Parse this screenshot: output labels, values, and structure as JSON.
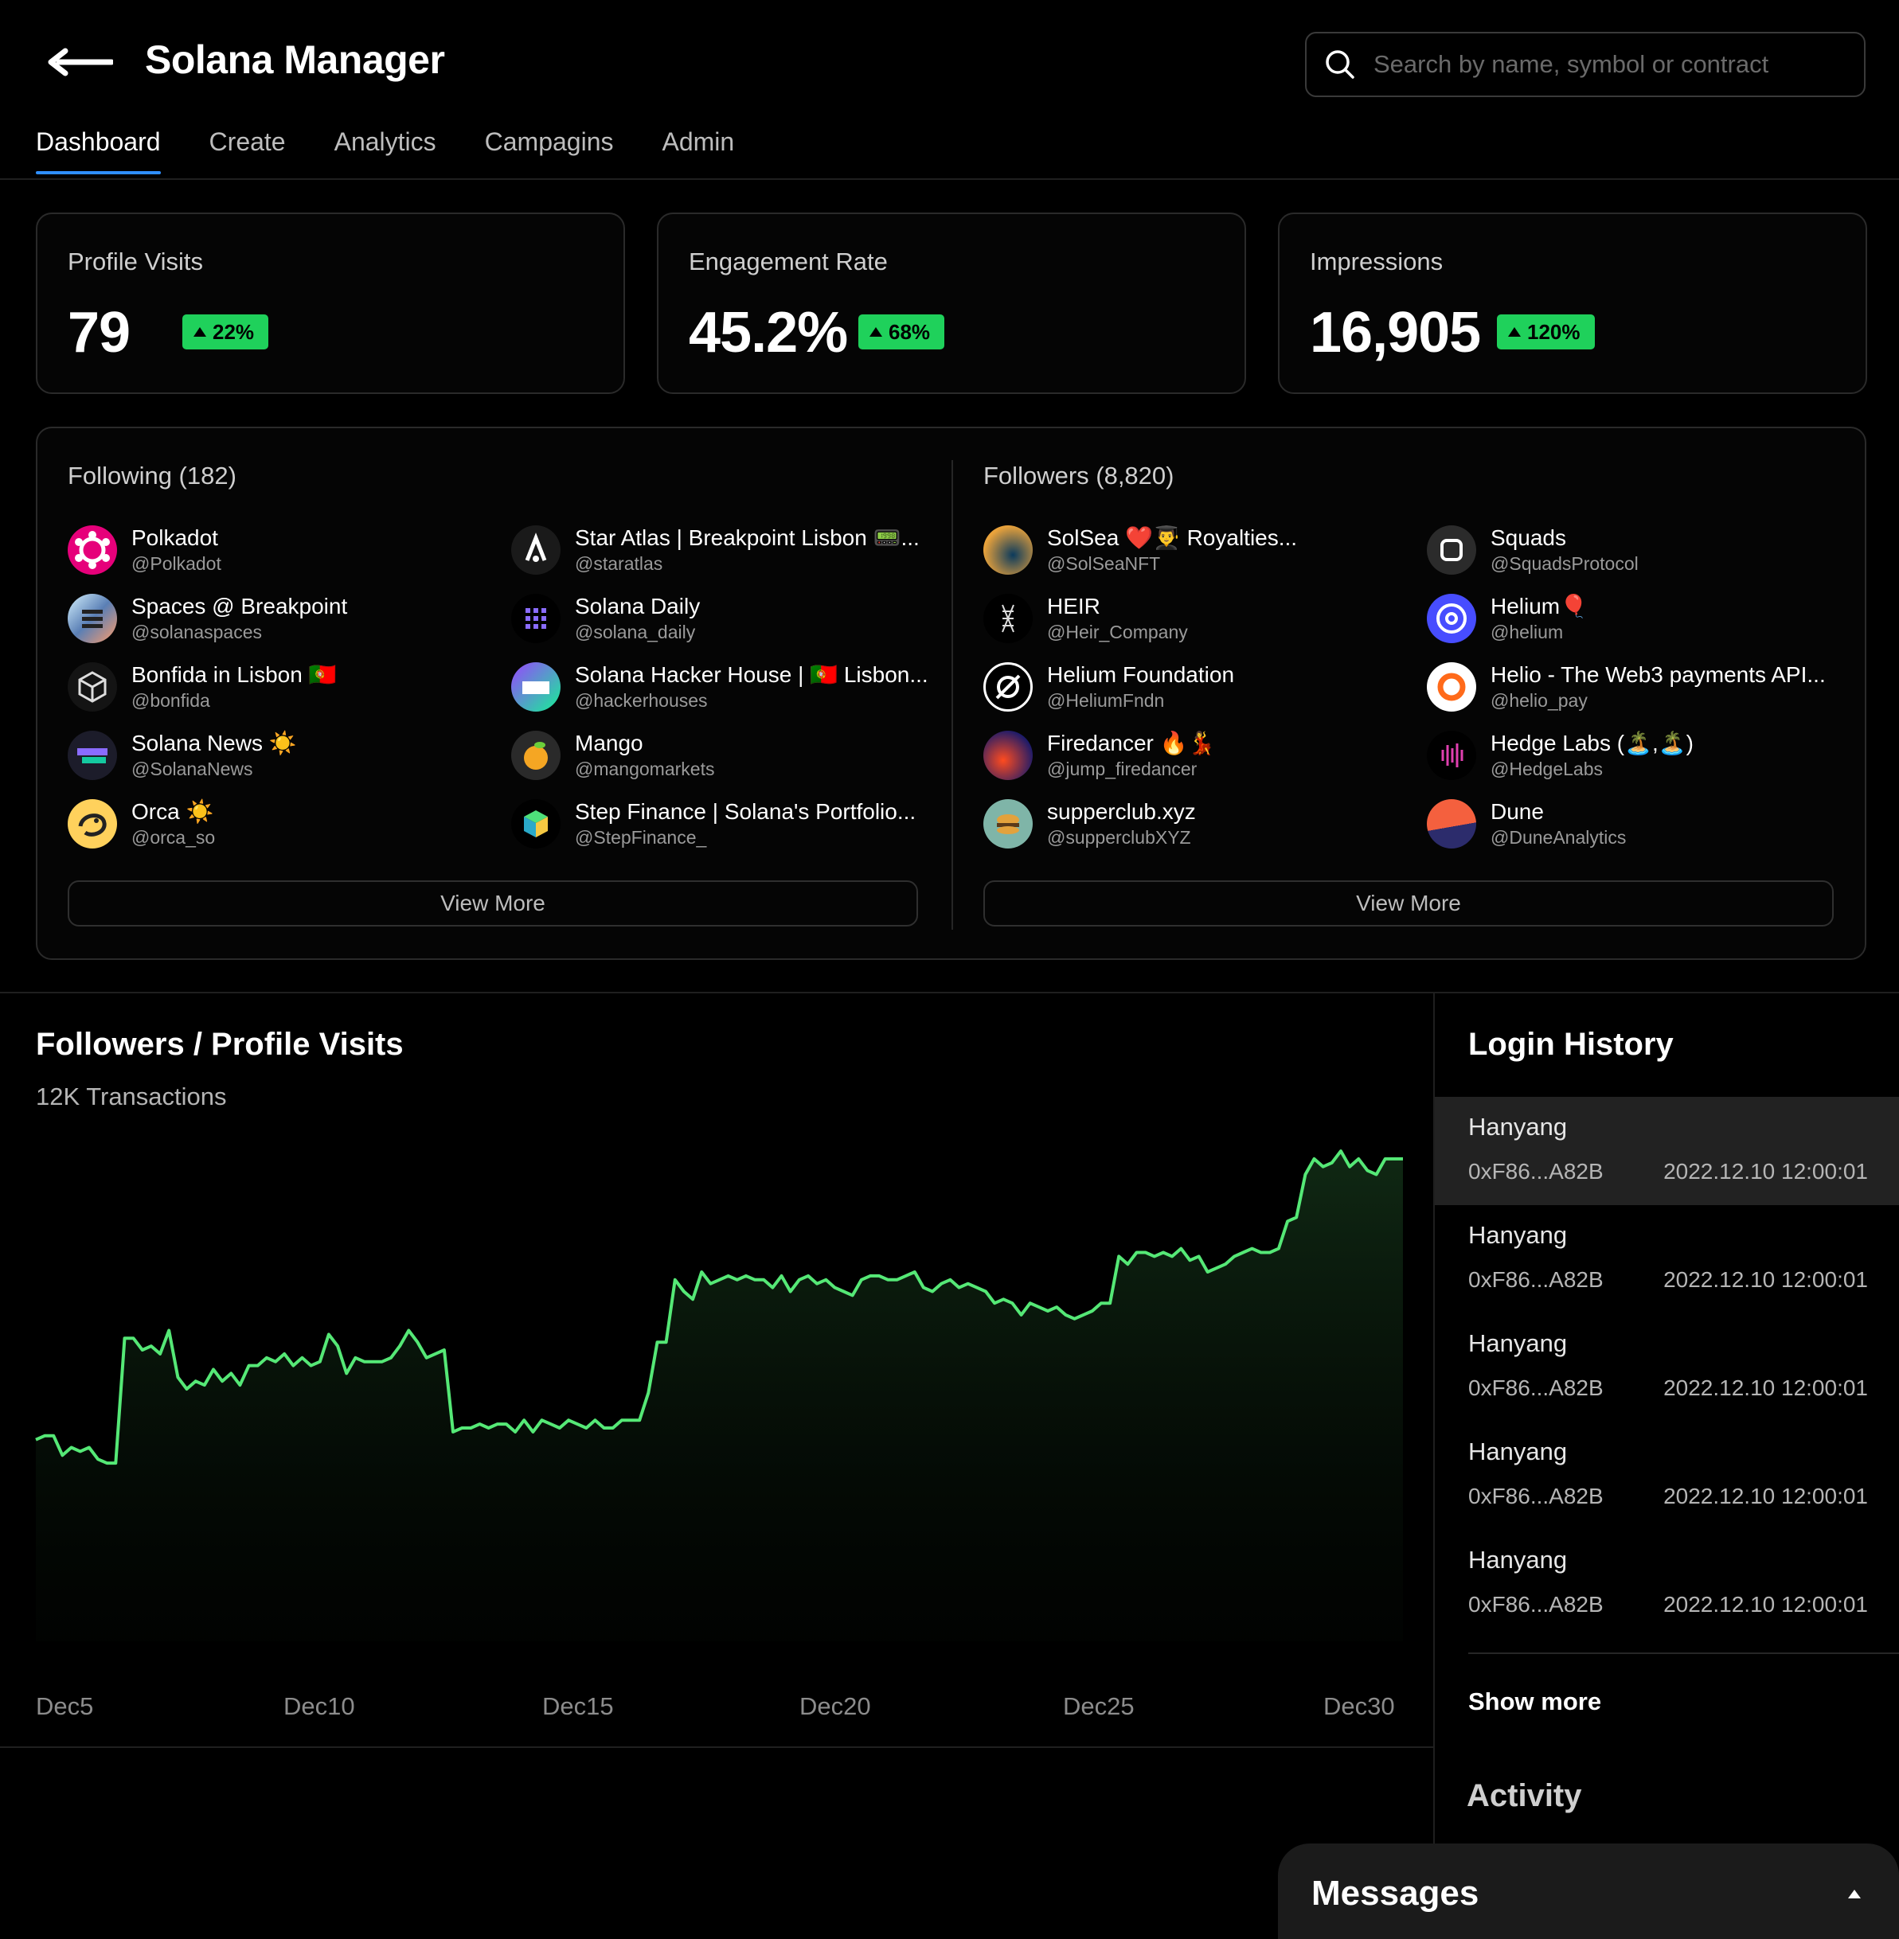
{
  "header": {
    "title": "Solana Manager",
    "search_placeholder": "Search by name, symbol or contract",
    "tabs": [
      "Dashboard",
      "Create",
      "Analytics",
      "Campagins",
      "Admin"
    ],
    "active_tab": "Dashboard"
  },
  "stats": [
    {
      "label": "Profile Visits",
      "value": "79",
      "change": "22%"
    },
    {
      "label": "Engagement Rate",
      "value": "45.2%",
      "change": "68%"
    },
    {
      "label": "Impressions",
      "value": "16,905",
      "change": "120%"
    }
  ],
  "following": {
    "title": "Following (182)",
    "view_more": "View More",
    "items": [
      {
        "name": "Polkadot",
        "handle": "@Polkadot"
      },
      {
        "name": "Star Atlas | Breakpoint Lisbon 📟...",
        "handle": "@staratlas"
      },
      {
        "name": "Spaces @ Breakpoint",
        "handle": "@solanaspaces"
      },
      {
        "name": "Solana Daily",
        "handle": "@solana_daily"
      },
      {
        "name": "Bonfida in Lisbon 🇵🇹",
        "handle": "@bonfida"
      },
      {
        "name": "Solana Hacker House | 🇵🇹 Lisbon...",
        "handle": "@hackerhouses"
      },
      {
        "name": "Solana News ☀️",
        "handle": "@SolanaNews"
      },
      {
        "name": "Mango",
        "handle": "@mangomarkets"
      },
      {
        "name": "Orca ☀️",
        "handle": "@orca_so"
      },
      {
        "name": "Step Finance | Solana's Portfolio...",
        "handle": "@StepFinance_"
      }
    ]
  },
  "followers": {
    "title": "Followers (8,820)",
    "view_more": "View More",
    "items": [
      {
        "name": "SolSea ❤️👨‍🎓 Royalties...",
        "handle": "@SolSeaNFT"
      },
      {
        "name": "Squads",
        "handle": "@SquadsProtocol"
      },
      {
        "name": "HEIR",
        "handle": "@Heir_Company"
      },
      {
        "name": "Helium🎈",
        "handle": "@helium"
      },
      {
        "name": "Helium Foundation",
        "handle": "@HeliumFndn"
      },
      {
        "name": "Helio - The Web3 payments API...",
        "handle": "@helio_pay"
      },
      {
        "name": "Firedancer 🔥💃",
        "handle": "@jump_firedancer"
      },
      {
        "name": "Hedge Labs (🏝️,🏝️)",
        "handle": "@HedgeLabs"
      },
      {
        "name": "supperclub.xyz",
        "handle": "@supperclubXYZ"
      },
      {
        "name": "Dune",
        "handle": "@DuneAnalytics"
      }
    ]
  },
  "chart_panel": {
    "title": "Followers / Profile Visits",
    "subtitle": "12K Transactions"
  },
  "chart_data": {
    "type": "area",
    "x_ticks": [
      "Dec5",
      "Dec10",
      "Dec15",
      "Dec20",
      "Dec25",
      "Dec30"
    ],
    "y": [
      17,
      18,
      18,
      13,
      15,
      14,
      15,
      12,
      11,
      11,
      43,
      43,
      40,
      41,
      39,
      45,
      33,
      30,
      32,
      31,
      35,
      32,
      34,
      31,
      36,
      36,
      38,
      37,
      39,
      36,
      38,
      36,
      37,
      44,
      41,
      34,
      38,
      37,
      37,
      37,
      38,
      41,
      45,
      42,
      38,
      39,
      40,
      19,
      20,
      20,
      21,
      20,
      21,
      21,
      19,
      22,
      19,
      22,
      21,
      20,
      22,
      21,
      20,
      22,
      20,
      20,
      22,
      22,
      22,
      29,
      42,
      42,
      58,
      55,
      53,
      60,
      57,
      58,
      59,
      58,
      59,
      58,
      58,
      56,
      59,
      55,
      58,
      59,
      57,
      58,
      56,
      55,
      54,
      58,
      59,
      59,
      58,
      58,
      59,
      60,
      56,
      55,
      57,
      58,
      56,
      57,
      56,
      55,
      52,
      53,
      52,
      49,
      52,
      51,
      50,
      51,
      49,
      48,
      49,
      50,
      52,
      52,
      64,
      62,
      65,
      65,
      64,
      65,
      64,
      66,
      63,
      64,
      60,
      61,
      62,
      64,
      65,
      66,
      65,
      65,
      66,
      73,
      74,
      85,
      89,
      87,
      88,
      91,
      87,
      89,
      86,
      85,
      89,
      89,
      89
    ],
    "title": "Followers / Profile Visits",
    "line_color": "#55e876",
    "grid": false
  },
  "login_history": {
    "title": "Login History",
    "rows": [
      {
        "city": "Hanyang",
        "address": "0xF86...A82B",
        "time": "2022.12.10 12:00:01"
      },
      {
        "city": "Hanyang",
        "address": "0xF86...A82B",
        "time": "2022.12.10 12:00:01"
      },
      {
        "city": "Hanyang",
        "address": "0xF86...A82B",
        "time": "2022.12.10 12:00:01"
      },
      {
        "city": "Hanyang",
        "address": "0xF86...A82B",
        "time": "2022.12.10 12:00:01"
      },
      {
        "city": "Hanyang",
        "address": "0xF86...A82B",
        "time": "2022.12.10 12:00:01"
      }
    ],
    "show_more": "Show more"
  },
  "activity": {
    "title": "Activity"
  },
  "messages": {
    "title": "Messages"
  }
}
